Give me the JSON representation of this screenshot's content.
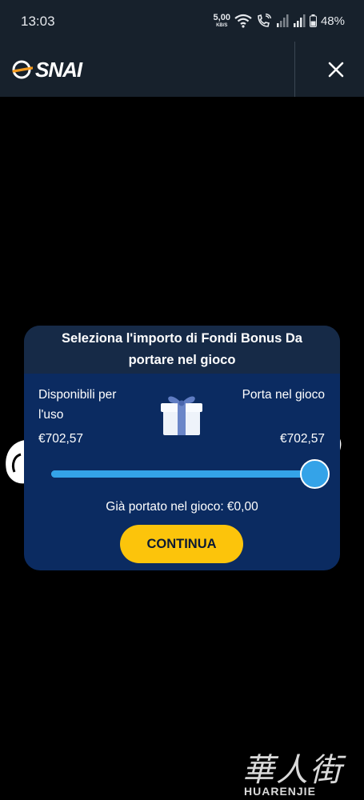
{
  "status_bar": {
    "time": "13:03",
    "speed_value": "5,00",
    "speed_unit": "KB/S",
    "battery": "48%"
  },
  "header": {
    "logo_text": "SNAI",
    "close_icon": "close-icon"
  },
  "modal": {
    "title": "Seleziona l'importo di Fondi Bonus Da portare nel gioco",
    "available_label": "Disponibili per l'uso",
    "carry_label": "Porta nel gioco",
    "available_value": "€702,57",
    "carry_value": "€702,57",
    "gift_icon": "gift-icon",
    "slider_fraction": 1.0,
    "brought_text": "Già portato nel gioco: €0,00",
    "continue_label": "CONTINUA"
  },
  "colors": {
    "header_bg": "#17212c",
    "modal_bg": "#0b2b61",
    "modal_head_bg": "#162a47",
    "slider": "#34a3e8",
    "button": "#fcc40b"
  },
  "watermark": {
    "chars": "華人街",
    "latin": "HUARENJIE"
  }
}
